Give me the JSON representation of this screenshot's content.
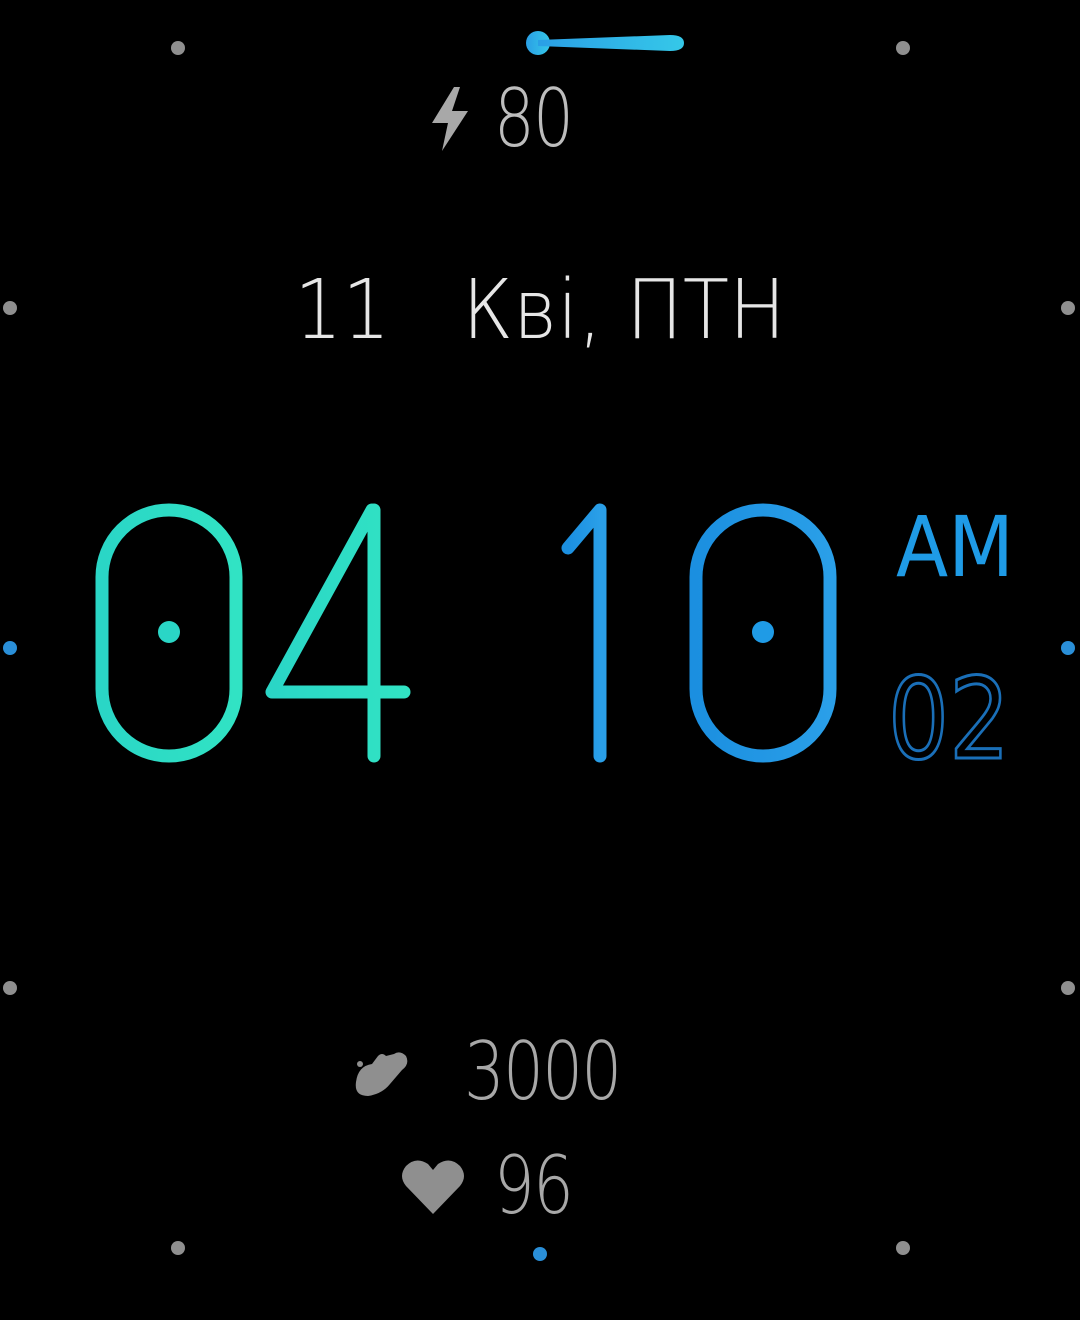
{
  "battery": {
    "icon": "lightning-bolt-icon",
    "value": "80"
  },
  "date": {
    "day": "11",
    "month_weekday": "Кві, ПТН"
  },
  "time": {
    "hours": "04",
    "minutes": "10",
    "period": "AM",
    "seconds": "02"
  },
  "steps": {
    "icon": "steps-icon",
    "value": "3000"
  },
  "heart_rate": {
    "icon": "heart-icon",
    "value": "96"
  },
  "colors": {
    "background": "#000000",
    "hours_accent": "#2fe0c8",
    "minutes_accent": "#1f9be6",
    "seconds_accent": "#1a6fb8",
    "text_primary": "#e6e6e6",
    "text_secondary": "#a8a8a8",
    "marker": "#8f8f8f",
    "marker_accent": "#2a8fd8"
  }
}
